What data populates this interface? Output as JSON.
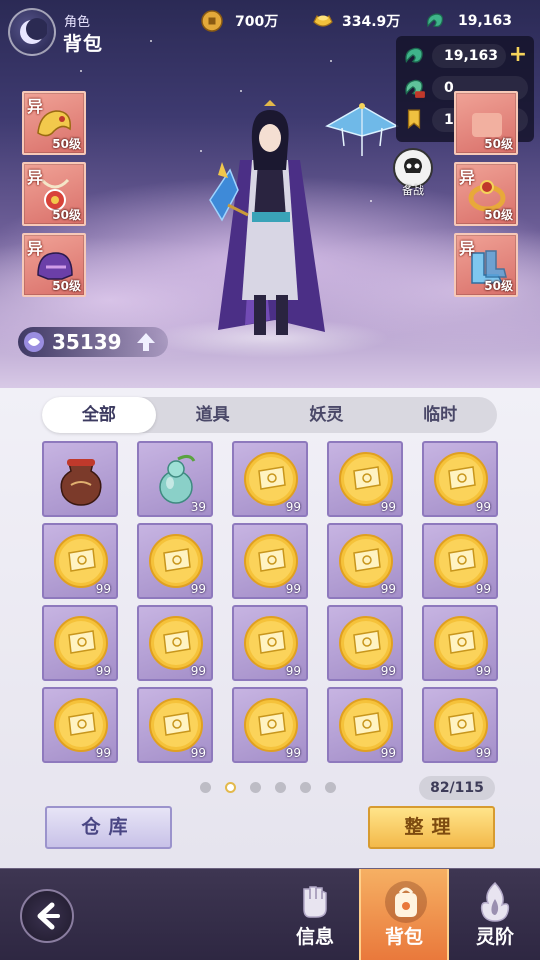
{
  "header": {
    "subtitle": "角色",
    "title": "背包",
    "currencies": [
      {
        "icon": "copper-coin-icon",
        "value": "700万"
      },
      {
        "icon": "gold-ingot-icon",
        "value": "334.9万"
      },
      {
        "icon": "jade-dragon-icon",
        "value": "19,163"
      }
    ]
  },
  "currency_panel": {
    "rows": [
      {
        "icon": "jade-dragon-icon",
        "value": "19,163",
        "plus": "+"
      },
      {
        "icon": "bound-jade-icon",
        "value": "0"
      },
      {
        "icon": "honor-token-icon",
        "value": "10.1万"
      }
    ]
  },
  "equipment": {
    "left": [
      {
        "rarity": "异",
        "level": "50级",
        "icon": "golden-dragon-accessory-icon"
      },
      {
        "rarity": "异",
        "level": "50级",
        "icon": "pendant-icon"
      },
      {
        "rarity": "异",
        "level": "50级",
        "icon": "purple-helmet-icon"
      }
    ],
    "right": [
      {
        "rarity": "",
        "level": "50级",
        "icon": "hidden-slot-icon"
      },
      {
        "rarity": "异",
        "level": "50级",
        "icon": "ruby-ring-icon"
      },
      {
        "rarity": "异",
        "level": "50级",
        "icon": "crystal-boots-icon"
      }
    ]
  },
  "standby": {
    "label": "备战"
  },
  "power": {
    "value": "35139"
  },
  "tabs": [
    "全部",
    "道具",
    "妖灵",
    "临时"
  ],
  "active_tab": 0,
  "inventory": {
    "items": [
      {
        "icon": "clay-jar-icon",
        "count": ""
      },
      {
        "icon": "gourd-potion-icon",
        "count": "39"
      },
      {
        "icon": "golden-scroll-orb-icon",
        "count": "99"
      },
      {
        "icon": "golden-scroll-orb-icon",
        "count": "99"
      },
      {
        "icon": "golden-scroll-orb-icon",
        "count": "99"
      },
      {
        "icon": "golden-scroll-orb-icon",
        "count": "99"
      },
      {
        "icon": "golden-scroll-orb-icon",
        "count": "99"
      },
      {
        "icon": "golden-scroll-orb-icon",
        "count": "99"
      },
      {
        "icon": "golden-scroll-orb-icon",
        "count": "99"
      },
      {
        "icon": "golden-scroll-orb-icon",
        "count": "99"
      },
      {
        "icon": "golden-scroll-orb-icon",
        "count": "99"
      },
      {
        "icon": "golden-scroll-orb-icon",
        "count": "99"
      },
      {
        "icon": "golden-scroll-orb-icon",
        "count": "99"
      },
      {
        "icon": "golden-scroll-orb-icon",
        "count": "99"
      },
      {
        "icon": "golden-scroll-orb-icon",
        "count": "99"
      },
      {
        "icon": "golden-scroll-orb-icon",
        "count": "99"
      },
      {
        "icon": "golden-scroll-orb-icon",
        "count": "99"
      },
      {
        "icon": "golden-scroll-orb-icon",
        "count": "99"
      },
      {
        "icon": "golden-scroll-orb-icon",
        "count": "99"
      },
      {
        "icon": "golden-scroll-orb-icon",
        "count": "99"
      }
    ]
  },
  "pagination": {
    "pages": 6,
    "current": 2
  },
  "capacity": "82/115",
  "buttons": {
    "warehouse": "仓库",
    "sort": "整理"
  },
  "nav": {
    "items": [
      {
        "icon": "fist-icon",
        "label": "信息"
      },
      {
        "icon": "bag-icon",
        "label": "背包"
      },
      {
        "icon": "flame-icon",
        "label": "灵阶"
      }
    ],
    "active": 1
  },
  "colors": {
    "accent": "#f3b94a",
    "slot_rarity": "#d9706a",
    "item_bg": "#b6a2d6"
  }
}
